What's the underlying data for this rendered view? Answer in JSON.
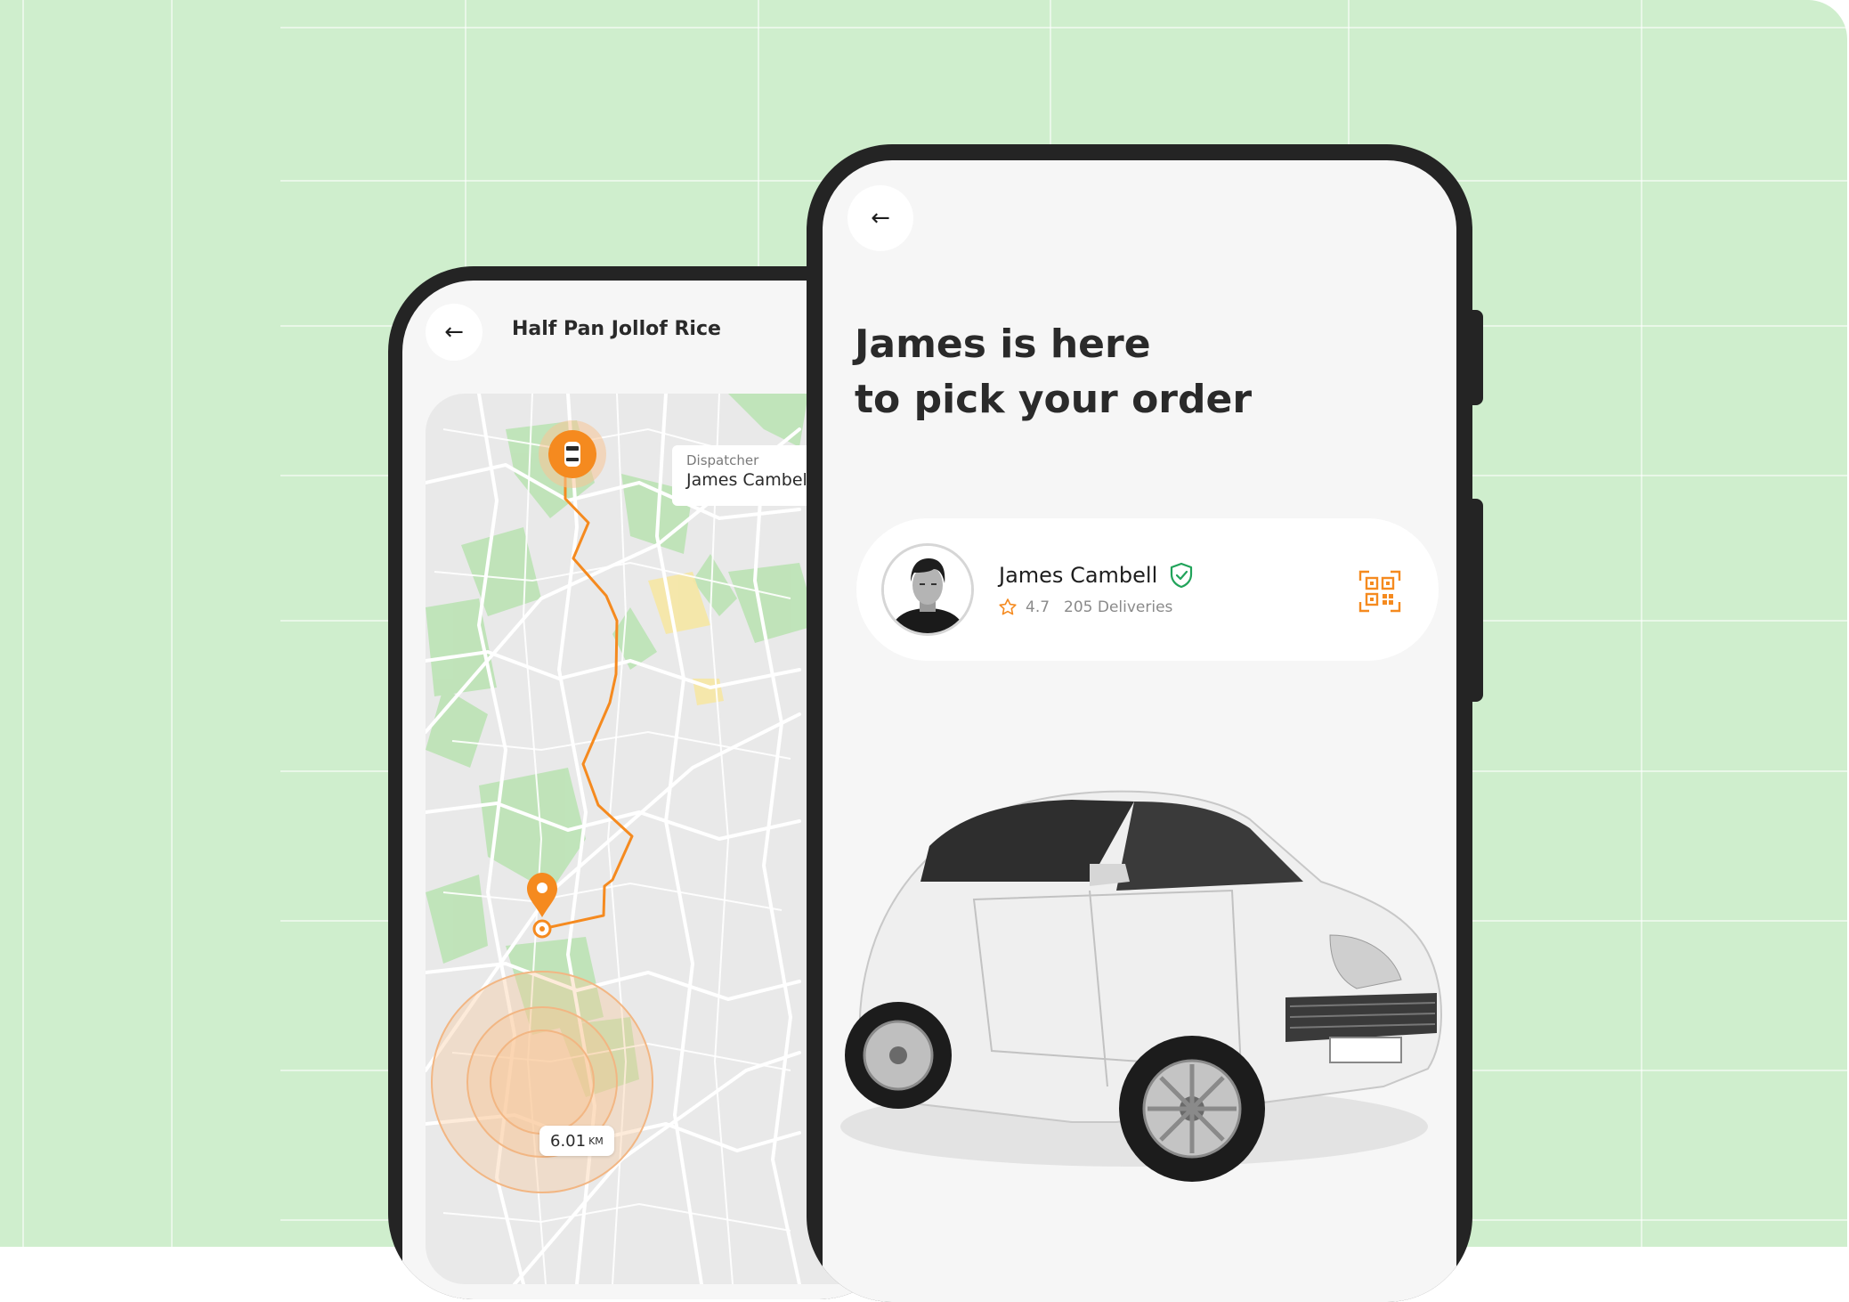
{
  "colors": {
    "background": "#cfeecd",
    "accent": "#f58a1f",
    "phone_frame": "#242424",
    "verified": "#21a35a"
  },
  "map_screen": {
    "back_icon": "arrow-left-icon",
    "title": "Half Pan Jollof Rice",
    "dispatcher": {
      "caption": "Dispatcher",
      "name": "James Cambell"
    },
    "distance": {
      "value": "6.01",
      "unit": "KM"
    }
  },
  "pickup_screen": {
    "back_icon": "arrow-left-icon",
    "headline": {
      "line1": "James is here",
      "line2": "to pick your order"
    },
    "driver": {
      "name": "James Cambell",
      "rating": "4.7",
      "deliveries": "205 Deliveries",
      "verified_icon": "shield-check-icon",
      "rating_icon": "star-icon",
      "action_icon": "qr-code-icon"
    }
  }
}
